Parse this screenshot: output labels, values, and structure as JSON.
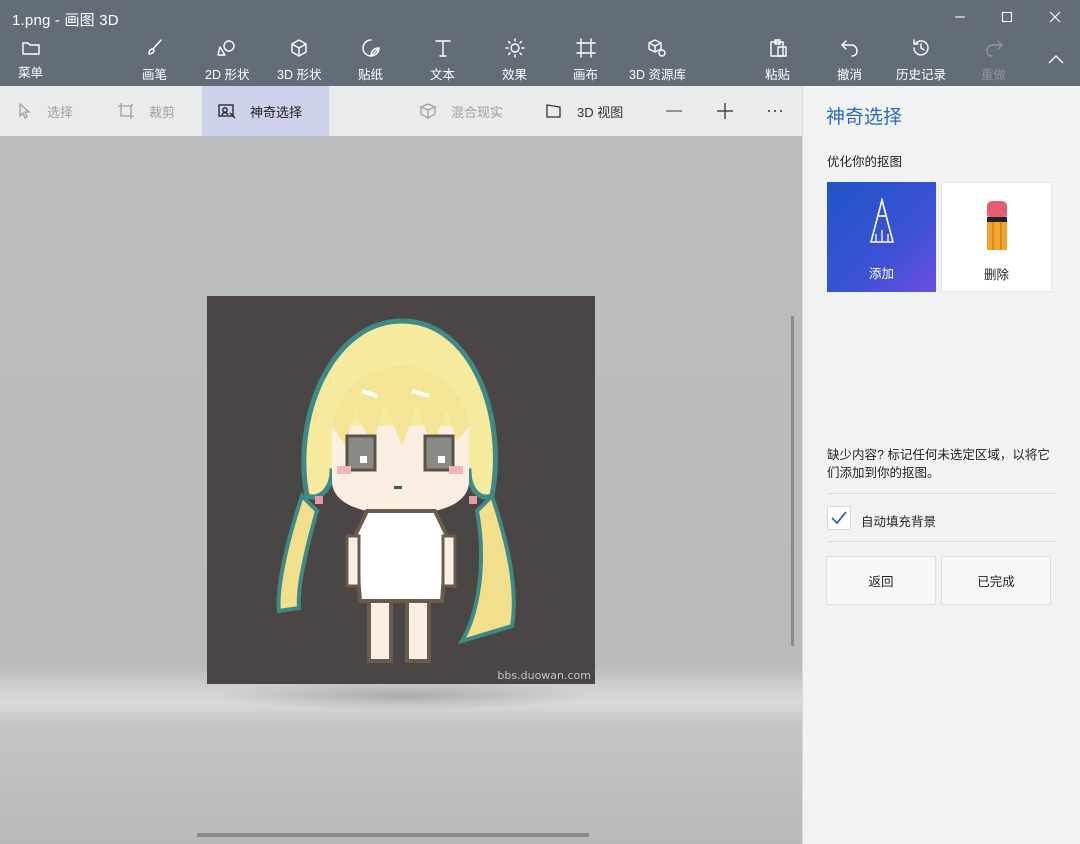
{
  "window": {
    "title": "1.png - 画图 3D",
    "controls": [
      "minimize-icon",
      "maximize-icon",
      "close-icon"
    ]
  },
  "ribbon": {
    "menu": "菜单",
    "items": [
      {
        "label": "画笔",
        "icon": "brush-icon"
      },
      {
        "label": "2D 形状",
        "icon": "2d-shapes-icon"
      },
      {
        "label": "3D 形状",
        "icon": "3d-shapes-icon"
      },
      {
        "label": "贴纸",
        "icon": "stickers-icon"
      },
      {
        "label": "文本",
        "icon": "text-icon"
      },
      {
        "label": "效果",
        "icon": "effects-icon"
      },
      {
        "label": "画布",
        "icon": "canvas-icon"
      },
      {
        "label": "3D 资源库",
        "icon": "3d-library-icon"
      }
    ],
    "paste": "粘贴",
    "undo": "撤消",
    "history": "历史记录",
    "redo": "重做"
  },
  "subtoolbar": {
    "select": "选择",
    "crop": "裁剪",
    "magic_select": "神奇选择",
    "mixed_reality": "混合现实",
    "view_3d": "3D 视图"
  },
  "canvas": {
    "watermark": "bbs.duowan.com",
    "artboard_color": "#4a4646"
  },
  "panel": {
    "title": "神奇选择",
    "subtitle": "优化你的抠图",
    "add": "添加",
    "remove": "删除",
    "hint": "缺少内容? 标记任何未选定区域，以将它们添加到你的抠图。",
    "autofill": "自动填充背景",
    "autofill_checked": true,
    "back": "返回",
    "done": "已完成"
  },
  "colors": {
    "accent": "#2b6cb9",
    "ribbon_bg": "#636d78",
    "add_tool_gradient": [
      "#1f55c4",
      "#6a4fe0"
    ]
  }
}
